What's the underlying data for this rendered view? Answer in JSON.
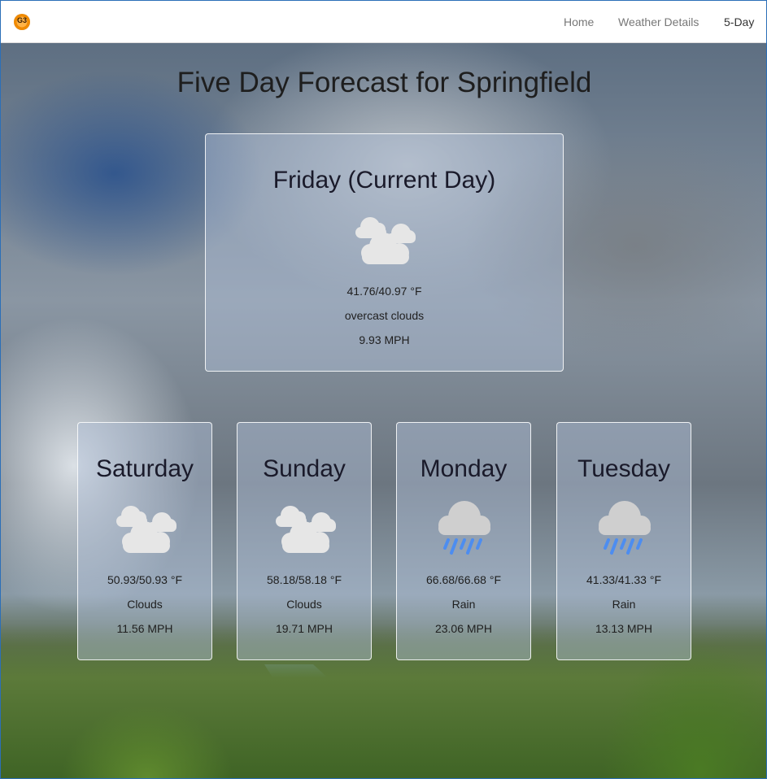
{
  "nav": {
    "logo_text": "G3",
    "links": [
      "Home",
      "Weather Details",
      "5-Day"
    ],
    "active": "5-Day"
  },
  "page": {
    "title": "Five Day Forecast for Springfield"
  },
  "current": {
    "day": "Friday (Current Day)",
    "icon": "cloudy-icon",
    "temp": "41.76/40.97 °F",
    "description": "overcast clouds",
    "wind": "9.93 MPH"
  },
  "forecast": [
    {
      "day": "Saturday",
      "icon": "cloudy-icon",
      "temp": "50.93/50.93 °F",
      "description": "Clouds",
      "wind": "11.56 MPH"
    },
    {
      "day": "Sunday",
      "icon": "cloudy-icon",
      "temp": "58.18/58.18 °F",
      "description": "Clouds",
      "wind": "19.71 MPH"
    },
    {
      "day": "Monday",
      "icon": "rain-icon",
      "temp": "66.68/66.68 °F",
      "description": "Rain",
      "wind": "23.06 MPH"
    },
    {
      "day": "Tuesday",
      "icon": "rain-icon",
      "temp": "41.33/41.33 °F",
      "description": "Rain",
      "wind": "13.13 MPH"
    }
  ],
  "colors": {
    "rain": "#4d8df0",
    "cloud": "#e6e6e6",
    "card_border": "#ffffff"
  }
}
